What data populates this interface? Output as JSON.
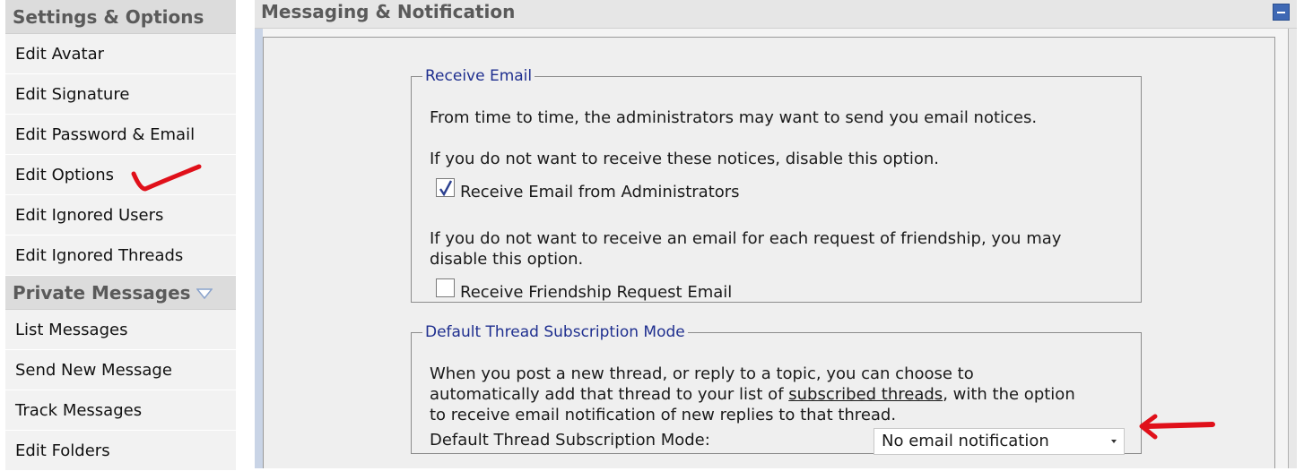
{
  "sidebar": {
    "settings_header": "Settings & Options",
    "settings_items": [
      {
        "label": "Edit Avatar"
      },
      {
        "label": "Edit Signature"
      },
      {
        "label": "Edit Password & Email"
      },
      {
        "label": "Edit Options"
      },
      {
        "label": "Edit Ignored Users"
      },
      {
        "label": "Edit Ignored Threads"
      }
    ],
    "pm_header": "Private Messages",
    "pm_items": [
      {
        "label": "List Messages"
      },
      {
        "label": "Send New Message"
      },
      {
        "label": "Track Messages"
      },
      {
        "label": "Edit Folders"
      }
    ]
  },
  "main": {
    "title": "Messaging & Notification",
    "receive_email": {
      "legend": "Receive Email",
      "intro": "From time to time, the administrators may want to send you email notices.",
      "notice_text": "If you do not want to receive these notices, disable this option.",
      "admin_checkbox_label": "Receive Email from Administrators",
      "admin_checked": true,
      "friend_text_line1": "If you do not want to receive an email for each request of friendship, you may",
      "friend_text_line2": "disable this option.",
      "friend_checkbox_label": "Receive Friendship Request Email",
      "friend_checked": false
    },
    "subscription": {
      "legend": "Default Thread Subscription Mode",
      "desc_line1": "When you post a new thread, or reply to a topic, you can choose to",
      "desc_line2_pre": "automatically add that thread to your list of ",
      "desc_line2_link": "subscribed threads",
      "desc_line2_post": ", with the option",
      "desc_line3": "to receive email notification of new replies to that thread.",
      "mode_label": "Default Thread Subscription Mode:",
      "mode_value": "No email notification"
    }
  },
  "colors": {
    "legend": "#1f2f8f",
    "annotation": "#e0101a",
    "collapse_button": "#3e68b4"
  }
}
